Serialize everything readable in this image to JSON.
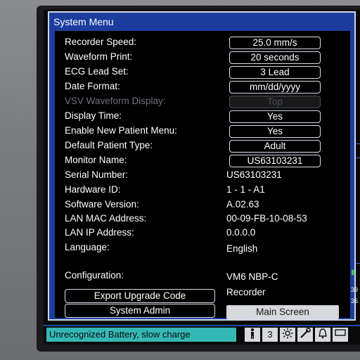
{
  "dialog": {
    "title": "System Menu"
  },
  "settings": [
    {
      "label": "Recorder Speed:",
      "value": "25.0 mm/s",
      "boxed": true,
      "dim": false
    },
    {
      "label": "Waveform Print:",
      "value": "20 seconds",
      "boxed": true,
      "dim": false
    },
    {
      "label": "ECG Lead Set:",
      "value": "3 Lead",
      "boxed": true,
      "dim": false
    },
    {
      "label": "Date Format:",
      "value": "mm/dd/yyyy",
      "boxed": true,
      "dim": false
    },
    {
      "label": "VSV Waveform Display:",
      "value": "Top",
      "boxed": true,
      "dim": true
    },
    {
      "label": "Display Time:",
      "value": "Yes",
      "boxed": true,
      "dim": false
    },
    {
      "label": "Enable New Patient Menu:",
      "value": "Yes",
      "boxed": true,
      "dim": false
    },
    {
      "label": "Default Patient Type:",
      "value": "Adult",
      "boxed": true,
      "dim": false
    },
    {
      "label": "Monitor Name:",
      "value": "US63103231",
      "boxed": true,
      "dim": false
    },
    {
      "label": "Serial Number:",
      "value": "US63103231",
      "boxed": false,
      "dim": false
    },
    {
      "label": "Hardware ID:",
      "value": "1 - 1 - A1",
      "boxed": false,
      "dim": false
    },
    {
      "label": "Software Version:",
      "value": "A.02.63",
      "boxed": false,
      "dim": false
    },
    {
      "label": "LAN MAC Address:",
      "value": "00-09-FB-10-08-53",
      "boxed": false,
      "dim": false
    },
    {
      "label": "LAN IP Address:",
      "value": "0.0.0.0",
      "boxed": false,
      "dim": false
    },
    {
      "label": "Language:",
      "value": "English",
      "boxed": false,
      "dim": false
    }
  ],
  "configuration": {
    "label": "Configuration:",
    "value_line1": "VM6 NBP-C",
    "value_line2": "Recorder"
  },
  "buttons": {
    "export": "Export Upgrade Code",
    "admin": "System Admin",
    "main_screen": "Main Screen"
  },
  "status": {
    "message": "Unrecognized Battery, slow charge",
    "icons": [
      "person-icon",
      "lead-count-icon",
      "brightness-icon",
      "tools-icon",
      "alarm-bell-icon",
      "display-icon"
    ],
    "lead_count": "3"
  },
  "side": {
    "values": [
      "39",
      "36"
    ]
  },
  "colors": {
    "dialog_frame": "#1c3d9e",
    "status_msg": "#34b8b4"
  }
}
